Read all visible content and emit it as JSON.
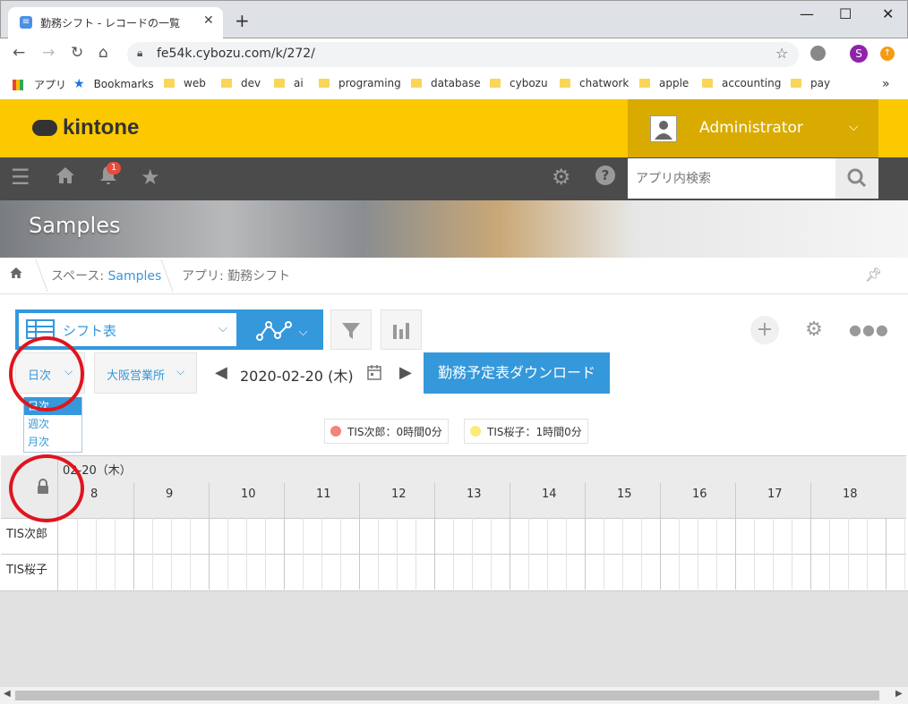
{
  "browser": {
    "tab_title": "勤務シフト - レコードの一覧",
    "url": "fe54k.cybozu.com/k/272/",
    "profile_initial": "S",
    "bookmarks": [
      {
        "label": "アプリ",
        "type": "apps"
      },
      {
        "label": "Bookmarks",
        "type": "star"
      },
      {
        "label": "web",
        "type": "folder"
      },
      {
        "label": "dev",
        "type": "folder"
      },
      {
        "label": "ai",
        "type": "folder"
      },
      {
        "label": "programing",
        "type": "folder"
      },
      {
        "label": "database",
        "type": "folder"
      },
      {
        "label": "cybozu",
        "type": "folder"
      },
      {
        "label": "chatwork",
        "type": "folder"
      },
      {
        "label": "apple",
        "type": "folder"
      },
      {
        "label": "accounting",
        "type": "folder"
      },
      {
        "label": "pay",
        "type": "folder"
      }
    ],
    "more_bookmarks": "»"
  },
  "kintone": {
    "logo": "kintone",
    "user": "Administrator",
    "notification_count": "1",
    "search_placeholder": "アプリ内検索",
    "space_title": "Samples",
    "breadcrumb": {
      "space_prefix": "スペース: ",
      "space_link": "Samples",
      "app": "アプリ: 勤務シフト"
    }
  },
  "view": {
    "selected_view": "シフト表",
    "period_selected": "日次",
    "period_options": [
      "日次",
      "週次",
      "月次"
    ],
    "office": "大阪営業所",
    "date": "2020-02-20 (木)",
    "download_label": "勤務予定表ダウンロード",
    "legend": [
      {
        "label": "TIS次郎：0時間0分",
        "color": "#f28479"
      },
      {
        "label": "TIS桜子：1時間0分",
        "color": "#fdea7a"
      }
    ]
  },
  "grid": {
    "day_header": "02-20（木）",
    "hours": [
      "8",
      "9",
      "10",
      "11",
      "12",
      "13",
      "14",
      "15",
      "16",
      "17",
      "18"
    ],
    "rows": [
      "TIS次郎",
      "TIS桜子"
    ]
  },
  "colors": {
    "brand_yellow": "#fcc800",
    "accent_blue": "#3498db",
    "annotation_red": "#e0141e"
  }
}
